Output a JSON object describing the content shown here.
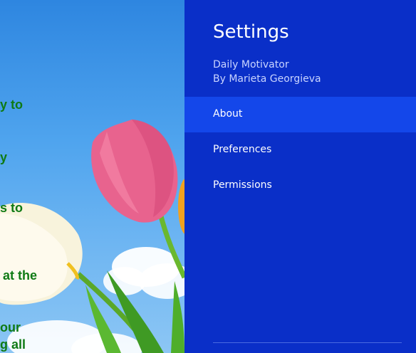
{
  "background": {
    "quote_lines": [
      "y to",
      "y",
      "s to",
      "at the",
      "our",
      "g all"
    ]
  },
  "settings": {
    "title": "Settings",
    "app_name": "Daily Motivator",
    "author": "By Marieta Georgieva",
    "items": [
      {
        "label": "About",
        "selected": true
      },
      {
        "label": "Preferences",
        "selected": false
      },
      {
        "label": "Permissions",
        "selected": false
      }
    ]
  },
  "colors": {
    "pane_bg": "#0a2fc8",
    "selected_item_bg": "#1447ea",
    "quote_text": "#0f7a14"
  }
}
